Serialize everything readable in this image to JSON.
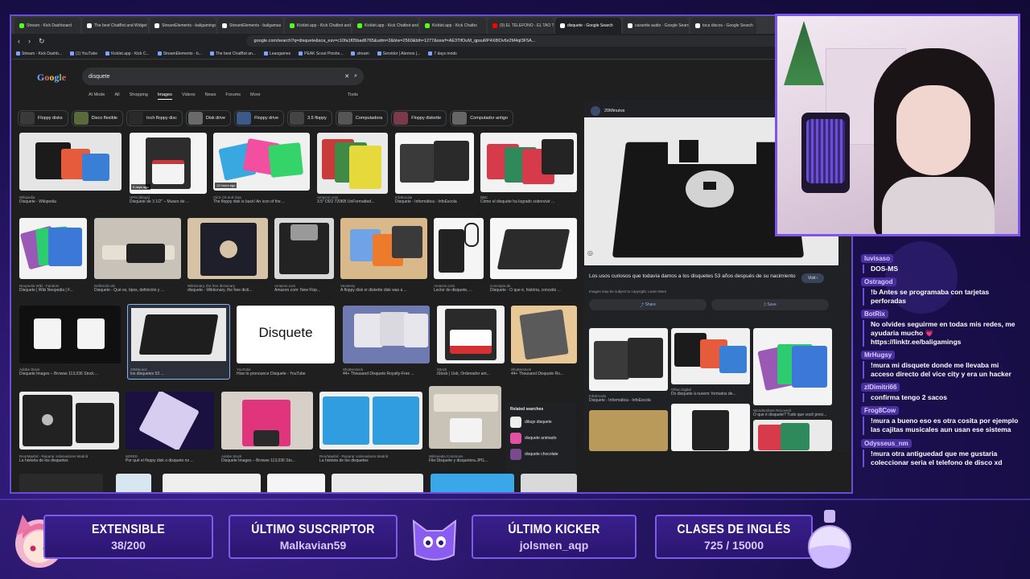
{
  "browser": {
    "tabs": [
      {
        "label": "Stream - Kick Dashboard",
        "color": "#53fc18"
      },
      {
        "label": "The best ChatBot and Widget",
        "color": "#ffffff"
      },
      {
        "label": "StreamElements - baligamings",
        "color": "#ffffff"
      },
      {
        "label": "StreamElements - baligamas",
        "color": "#ffffff"
      },
      {
        "label": "Kicklet.app - Kick Chatbot and",
        "color": "#53fc18"
      },
      {
        "label": "Kicklet.app - Kick Chatbot and",
        "color": "#53fc18"
      },
      {
        "label": "Kicklet.app - Kick Chatbo",
        "color": "#53fc18"
      },
      {
        "label": "(9) EL TELEFONO - EL TAO TAO",
        "color": "#ff0000"
      },
      {
        "label": "disquete - Google Search",
        "color": "#ffffff"
      },
      {
        "label": "cassette audio - Google Search",
        "color": "#ffffff"
      },
      {
        "label": "toca discos - Google Search",
        "color": "#ffffff"
      }
    ],
    "url": "google.com/search?q=disquete&sca_esv=c10fa1f05bad6765&udm=2&biw=2560&bih=1277&sxsrf=AE3TifOuM_qpsuRP4X8lOv6x2M4qt3F5A...",
    "bookmarks": [
      "Stream - Kick Dashb...",
      "(1) YouTube",
      "Kicklet.app - Kick C...",
      "StreamElements - b...",
      "The best ChatBot an...",
      "Leaogames",
      "PEAK Scout Pinshe...",
      "stream",
      "Servidor | Aternos |...",
      "7 days mods"
    ],
    "search_query": "disquete",
    "filters": [
      "AI Mode",
      "All",
      "Shopping",
      "Images",
      "Videos",
      "News",
      "Forums",
      "More"
    ],
    "active_filter": "Images",
    "tools_label": "Tools",
    "chips": [
      "Floppy disks",
      "Disco flexible",
      "Inch floppy disc",
      "Disk drive",
      "Floppy drive",
      "3.5 floppy",
      "Computadora",
      "Floppy diskette",
      "Computador antigo"
    ],
    "results": [
      {
        "source": "Wikipedia",
        "title": "Disquete - Wikipedia"
      },
      {
        "source": "UPM [Blogs]",
        "title": "Disquete de 3 1/2\" – Museo de ..."
      },
      {
        "source": "Click Oil and Gas",
        "title": "The floppy disk is back! An icon of the ..."
      },
      {
        "source": "Amazon.com",
        "title": "3.5\" DD2 720KB UnFormatted..."
      },
      {
        "source": "InfoEscola",
        "title": "Disquete - Informática - InfoEscola"
      },
      {
        "source": "BBC",
        "title": "Cómo el disquete ha logrado sobrevivir ..."
      },
      {
        "source": "Neopedia Wiki - Fandom",
        "title": "Disquete | Wiki Neopedia | F..."
      },
      {
        "source": "Definición.de",
        "title": "Disquete - Qué es, tipos, definición y ..."
      },
      {
        "source": "Wiktionary, the free dictionary",
        "title": "disquete - Wiktionary, the free dicti..."
      },
      {
        "source": "Amazon.com",
        "title": "Amazon.com: New Flop..."
      },
      {
        "source": "Vecteezy",
        "title": "A floppy disk or diskette disk was a ..."
      },
      {
        "source": "Amazon.com",
        "title": "Lector de disquete, ..."
      },
      {
        "source": "Concepto.de",
        "title": "Disquete - O que é, história, conceito ..."
      },
      {
        "source": "Adobe Stock",
        "title": "Disquete Images – Browse 113,036 Stock ..."
      },
      {
        "source": "20Minutos",
        "title": "los disquetes 53 ..."
      },
      {
        "source": "YouTube",
        "title": "How to pronounce Disquete - YouTube"
      },
      {
        "source": "Shutterstock",
        "title": "44+ Thousand Disquete Royalty-Free ..."
      },
      {
        "source": "iStock",
        "title": "iStock | Usb, Ordenador ant..."
      },
      {
        "source": "Shutterstock",
        "title": "44+ Thousand Disquete Ro..."
      },
      {
        "source": "ReorMadrid - Reparar ordenadores Madrid",
        "title": "La historia de los disquetes"
      },
      {
        "source": "WIRED",
        "title": "Por qué el floppy disk o disquete no ..."
      },
      {
        "source": "Adobe Stock",
        "title": "Disquete Images – Browse 113,036 Sto..."
      },
      {
        "source": "ReorMadrid - Reparar ordenadores Madrid",
        "title": "La historia de los disquetes"
      },
      {
        "source": "Wikimedia Commons",
        "title": "File:Disquete y disquetera.JPG..."
      }
    ],
    "disquete_text": "Disquete",
    "badges": {
      "days_ago": "6 days ago",
      "hours_ago": "12 hours ago"
    },
    "related_title": "Related searches",
    "related": [
      "dibujo disquete",
      "disquete animado",
      "disquete chocolate"
    ],
    "preview": {
      "source": "20Minutos",
      "title": "Los usos curiosos que todavía damos a los disquetes 53 años después de su nacimiento",
      "copyright": "Images may be subject to copyright. Learn More",
      "visit_label": "Visit",
      "share_label": "Share",
      "save_label": "Save",
      "thumbs": [
        {
          "source": "InfoEscola",
          "title": "Disquete - Informática - InfoEscola"
        },
        {
          "source": "Olhar Digital",
          "title": "Do disquete à nuvem: formatos de..."
        },
        {
          "source": "Wondershare Recoverit",
          "title": "O que é disquete? Tudo que você preci..."
        }
      ]
    }
  },
  "chat": [
    {
      "user": "luvisaso",
      "text": "DOS-MS"
    },
    {
      "user": "Ostragod",
      "text": "!b Antes se programaba con tarjetas perforadas"
    },
    {
      "user": "BotRix",
      "text": "No olvides seguirme en todas mis redes, me ayudaria mucho 💗 https://linktr.ee/baligamings"
    },
    {
      "user": "MrHugsy",
      "text": "!mura mi disquete donde me llevaba mi acceso directo del vice city y era un hacker"
    },
    {
      "user": "zlDimitri66",
      "text": "confirma tengo 2 sacos"
    },
    {
      "user": "Frog8Cow",
      "text": "!mura a bueno eso es otra cosita por ejemplo las cajitas musicales aun usan ese sistema"
    },
    {
      "user": "Odysseus_nm",
      "text": "!mura otra antiguedad que me gustaria coleccionar seria el telefono de disco xd"
    }
  ],
  "overlay": {
    "extensible": {
      "title": "EXTENSIBLE",
      "value": "38/200"
    },
    "suscriptor": {
      "title": "ÚLTIMO SUSCRIPTOR",
      "value": "Malkavian59"
    },
    "kicker": {
      "title": "ÚLTIMO KICKER",
      "value": "jolsmen_aqp"
    },
    "clases": {
      "title": "CLASES DE INGLÉS",
      "value": "725 / 15000"
    }
  },
  "colors": {
    "accent": "#7b56e8",
    "panel": "#2a1570",
    "kick": "#53fc18"
  }
}
